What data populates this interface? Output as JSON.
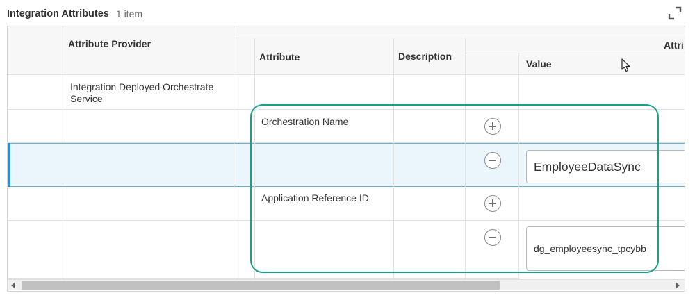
{
  "header": {
    "title": "Integration Attributes",
    "count": "1 item"
  },
  "icons": {
    "expand": "expand-icon",
    "add": "plus-circle-icon",
    "remove": "minus-circle-icon",
    "cursor": "mouse-pointer-icon"
  },
  "columns": {
    "attribute_provider": "Attribute Provider",
    "attribute": "Attribute",
    "description": "Description",
    "group": "Attri",
    "value": "Value"
  },
  "rows": [
    {
      "attribute_provider": "Integration Deployed Orchestrate Service"
    },
    {
      "attribute": "Orchestration Name",
      "value": "EmployeeDataSync"
    },
    {
      "attribute": "Application Reference ID",
      "value": "dg_employeesync_tpcybb"
    }
  ],
  "colors": {
    "highlight": "#1a9f8a",
    "selected_row": "#eaf6fc",
    "selected_bar": "#2a8fd6"
  }
}
